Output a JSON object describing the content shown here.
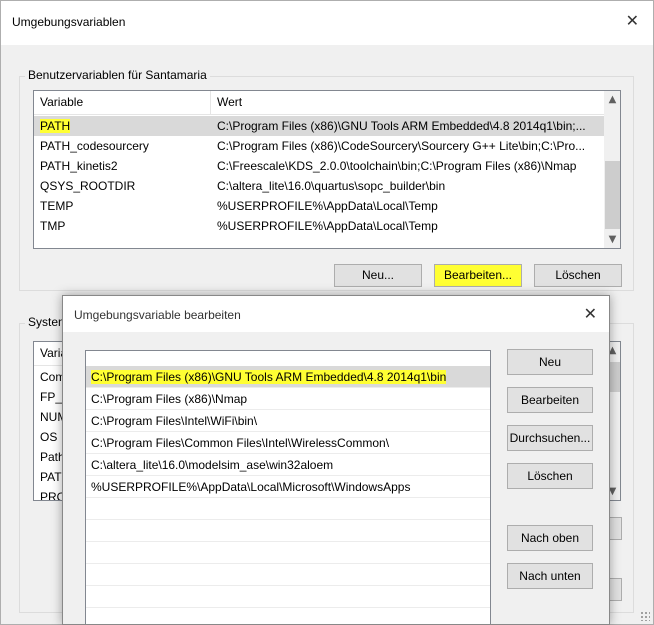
{
  "outer": {
    "title": "Umgebungsvariablen",
    "user_group": {
      "legend": "Benutzervariablen für Santamaria",
      "headers": [
        "Variable",
        "Wert"
      ],
      "rows": [
        {
          "variable": "PATH",
          "value": "C:\\Program Files (x86)\\GNU Tools ARM Embedded\\4.8 2014q1\\bin;..."
        },
        {
          "variable": "PATH_codesourcery",
          "value": "C:\\Program Files (x86)\\CodeSourcery\\Sourcery G++ Lite\\bin;C:\\Pro..."
        },
        {
          "variable": "PATH_kinetis2",
          "value": "C:\\Freescale\\KDS_2.0.0\\toolchain\\bin;C:\\Program Files (x86)\\Nmap"
        },
        {
          "variable": "QSYS_ROOTDIR",
          "value": "C:\\altera_lite\\16.0\\quartus\\sopc_builder\\bin"
        },
        {
          "variable": "TEMP",
          "value": "%USERPROFILE%\\AppData\\Local\\Temp"
        },
        {
          "variable": "TMP",
          "value": "%USERPROFILE%\\AppData\\Local\\Temp"
        }
      ],
      "buttons": {
        "new": "Neu...",
        "edit": "Bearbeiten...",
        "delete": "Löschen"
      }
    },
    "system_group": {
      "legend_partial": "Systen",
      "header_partial": "Varia",
      "rows_partial": [
        "Com",
        "FP_I",
        "NUM",
        "OS",
        "Path",
        "PATH",
        "PRO"
      ]
    }
  },
  "inner": {
    "title": "Umgebungsvariable bearbeiten",
    "paths": [
      "C:\\Program Files (x86)\\GNU Tools ARM Embedded\\4.8 2014q1\\bin",
      "C:\\Program Files (x86)\\Nmap",
      "C:\\Program Files\\Intel\\WiFi\\bin\\",
      "C:\\Program Files\\Common Files\\Intel\\WirelessCommon\\",
      "C:\\altera_lite\\16.0\\modelsim_ase\\win32aloem",
      "%USERPROFILE%\\AppData\\Local\\Microsoft\\WindowsApps"
    ],
    "buttons": {
      "new": "Neu",
      "edit": "Bearbeiten",
      "browse": "Durchsuchen...",
      "delete": "Löschen",
      "up": "Nach oben",
      "down": "Nach unten"
    }
  },
  "colors": {
    "highlight": "#ffff33",
    "selection": "#d9d9d9"
  },
  "icons": {
    "close": "close-icon",
    "scroll_up": "chevron-up-icon",
    "scroll_down": "chevron-down-icon"
  }
}
